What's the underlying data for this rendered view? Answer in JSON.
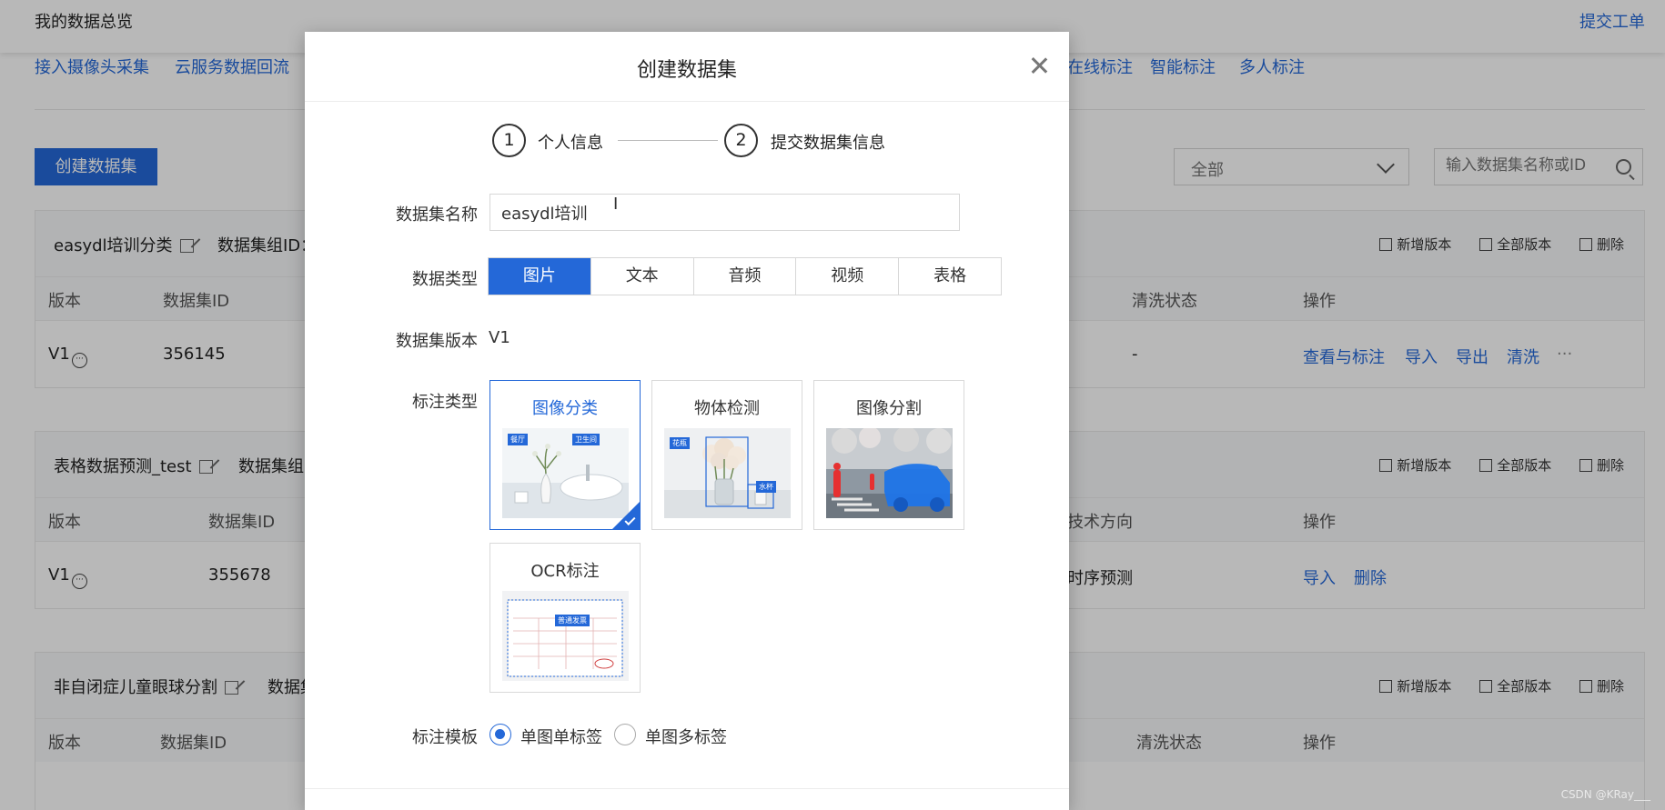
{
  "page": {
    "title": "我的数据总览",
    "ticket": "提交工单",
    "subnav": [
      "接入摄像头采集",
      "云服务数据回流",
      "在线标注",
      "智能标注",
      "多人标注"
    ],
    "create_button": "创建数据集",
    "filter_select": "全部",
    "search_placeholder": "输入数据集名称或ID",
    "actions": {
      "new_version": "新增版本",
      "all_versions": "全部版本",
      "delete": "删除"
    },
    "datasets": [
      {
        "name": "easydl培训分类",
        "group_label": "数据集组ID：",
        "columns": [
          "版本",
          "数据集ID",
          "清洗状态",
          "操作"
        ],
        "row": {
          "version": "V1",
          "id": "356145",
          "clean_status": "-",
          "ops": [
            "查看与标注",
            "导入",
            "导出",
            "清洗",
            "···"
          ]
        }
      },
      {
        "name": "表格数据预测_test",
        "group_label": "数据集组",
        "columns": [
          "版本",
          "数据集ID",
          "技术方向",
          "操作"
        ],
        "row": {
          "version": "V1",
          "id": "355678",
          "tech_direction": "时序预测",
          "ops": [
            "导入",
            "删除"
          ]
        }
      },
      {
        "name": "非自闭症儿童眼球分割",
        "group_label": "数据集",
        "columns": [
          "版本",
          "数据集ID",
          "清洗状态",
          "操作"
        ]
      }
    ],
    "watermark": "CSDN @KRay___"
  },
  "modal": {
    "title": "创建数据集",
    "steps": [
      {
        "num": "1",
        "label": "个人信息"
      },
      {
        "num": "2",
        "label": "提交数据集信息"
      }
    ],
    "name_label": "数据集名称",
    "name_value": "easydl培训",
    "type_label": "数据类型",
    "types": [
      "图片",
      "文本",
      "音频",
      "视频",
      "表格"
    ],
    "active_type": "图片",
    "version_label": "数据集版本",
    "version_value": "V1",
    "annotation_label": "标注类型",
    "annotation_types": [
      {
        "title": "图像分类",
        "tags": [
          "餐厅",
          "卫生间"
        ]
      },
      {
        "title": "物体检测",
        "tags": [
          "花瓶",
          "水杯"
        ]
      },
      {
        "title": "图像分割"
      },
      {
        "title": "OCR标注",
        "tags": [
          "普通发票"
        ]
      }
    ],
    "selected_annotation": "图像分类",
    "template_label": "标注模板",
    "templates": [
      "单图单标签",
      "单图多标签"
    ],
    "selected_template": "单图单标签",
    "colors": {
      "primary": "#2468d8"
    }
  }
}
